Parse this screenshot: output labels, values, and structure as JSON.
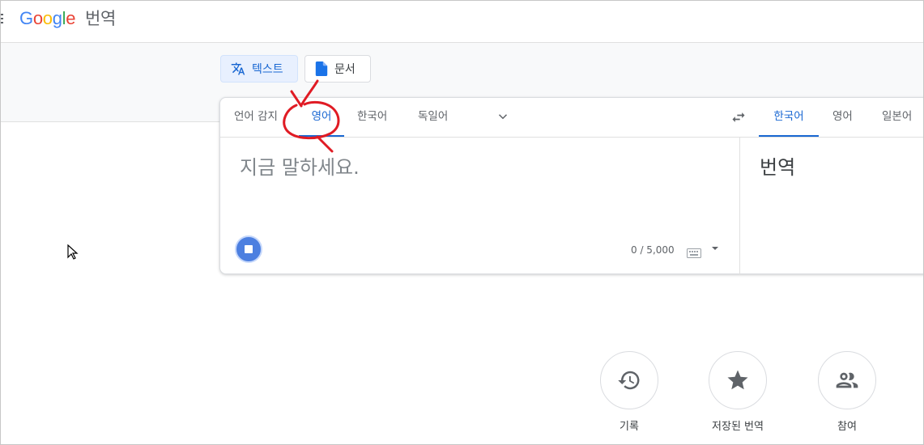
{
  "header": {
    "logo_letters": [
      "G",
      "o",
      "o",
      "g",
      "l",
      "e"
    ],
    "logo_colors": [
      "#4285f4",
      "#ea4335",
      "#fbbc05",
      "#4285f4",
      "#34a853",
      "#ea4335"
    ],
    "product": "번역"
  },
  "modes": [
    {
      "label": "텍스트",
      "icon": "translate-icon",
      "active": true
    },
    {
      "label": "문서",
      "icon": "document-icon",
      "active": false
    }
  ],
  "source_langs": {
    "detect": "언어 감지",
    "items": [
      "영어",
      "한국어",
      "독일어"
    ],
    "selected": "영어"
  },
  "target_langs": {
    "items": [
      "한국어",
      "영어",
      "일본어"
    ],
    "selected": "한국어"
  },
  "input": {
    "placeholder": "지금 말하세요.",
    "counter": "0 / 5,000"
  },
  "output": {
    "placeholder": "번역"
  },
  "actions": [
    {
      "label": "기록",
      "icon": "history-icon"
    },
    {
      "label": "저장된 번역",
      "icon": "star-icon"
    },
    {
      "label": "참여",
      "icon": "people-icon"
    }
  ],
  "colors": {
    "accent": "#1967d2",
    "annotation": "#e01b24"
  }
}
